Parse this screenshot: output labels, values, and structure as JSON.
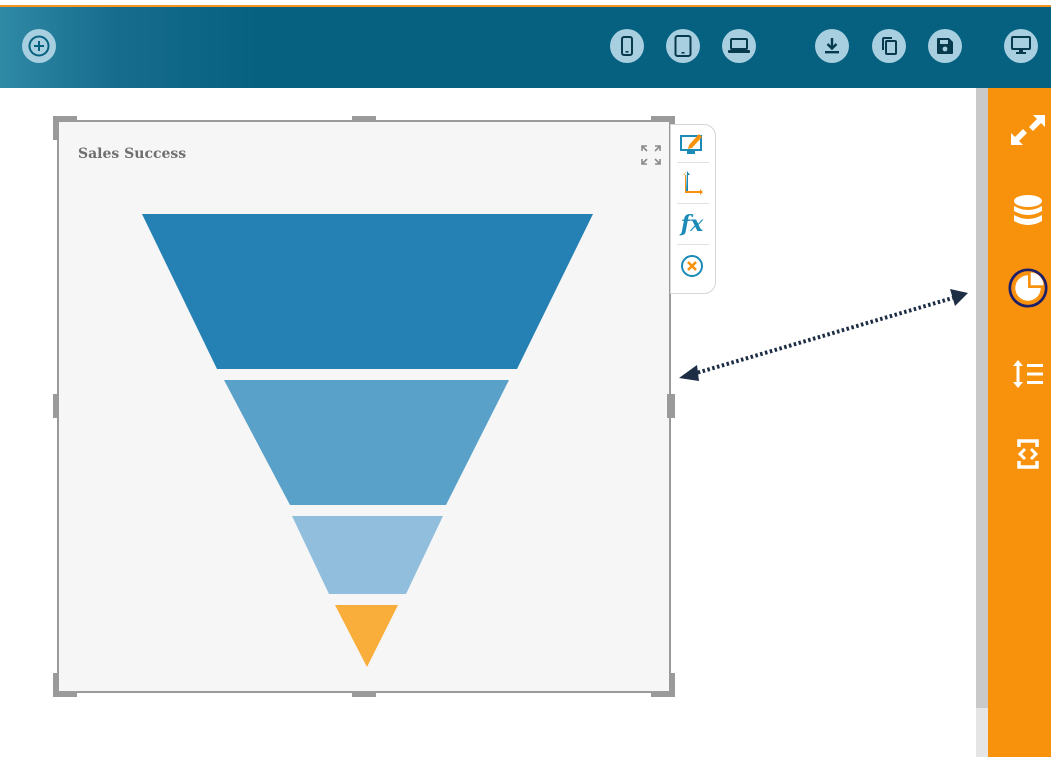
{
  "toolbar": {
    "add_icon": "plus-icon",
    "device_icons": [
      "mobile-icon",
      "tablet-icon",
      "laptop-icon"
    ],
    "action_icons": [
      "download-icon",
      "copy-icon",
      "save-icon"
    ],
    "preview_icon": "monitor-icon"
  },
  "widget": {
    "title": "Sales Success",
    "maximize_icon": "expand-icon",
    "tools": [
      "edit-widget-icon",
      "axis-icon",
      "formula-icon",
      "remove-icon"
    ],
    "formula_label": "fx"
  },
  "right_panel": {
    "icons": [
      "resize-icon",
      "datasource-icon",
      "chart-properties-icon",
      "sort-icon",
      "code-icon"
    ],
    "active": "chart-properties-icon"
  },
  "colors": {
    "topbar": "#06607f",
    "accent": "#f8920d",
    "stage_colors": [
      "#2581b4",
      "#5aa1c9",
      "#91bedd",
      "#f9ad3a"
    ]
  },
  "chart_data": {
    "type": "funnel",
    "title": "Sales Success",
    "stages": 4,
    "relative_widths": [
      1.0,
      0.63,
      0.33,
      0.14
    ]
  }
}
